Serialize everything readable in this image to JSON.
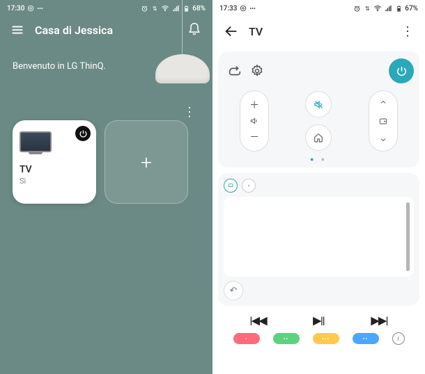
{
  "left": {
    "status": {
      "time": "17:30",
      "battery": "68%"
    },
    "header": {
      "title": "Casa di Jessica"
    },
    "welcome": "Benvenuto in LG ThinQ.",
    "cards": {
      "tv": {
        "title": "TV",
        "sub": "Sì"
      },
      "add_label": "+"
    }
  },
  "right": {
    "status": {
      "time": "17:33",
      "battery": "67%"
    },
    "header": {
      "title": "TV"
    },
    "volume": {
      "up": "＋",
      "down": "－"
    },
    "media": {
      "prev": "|◀◀",
      "play": "▶||",
      "next": "▶▶|"
    },
    "colors": {
      "red": "•",
      "green": "••",
      "yellow": "•••",
      "blue": "••"
    }
  }
}
